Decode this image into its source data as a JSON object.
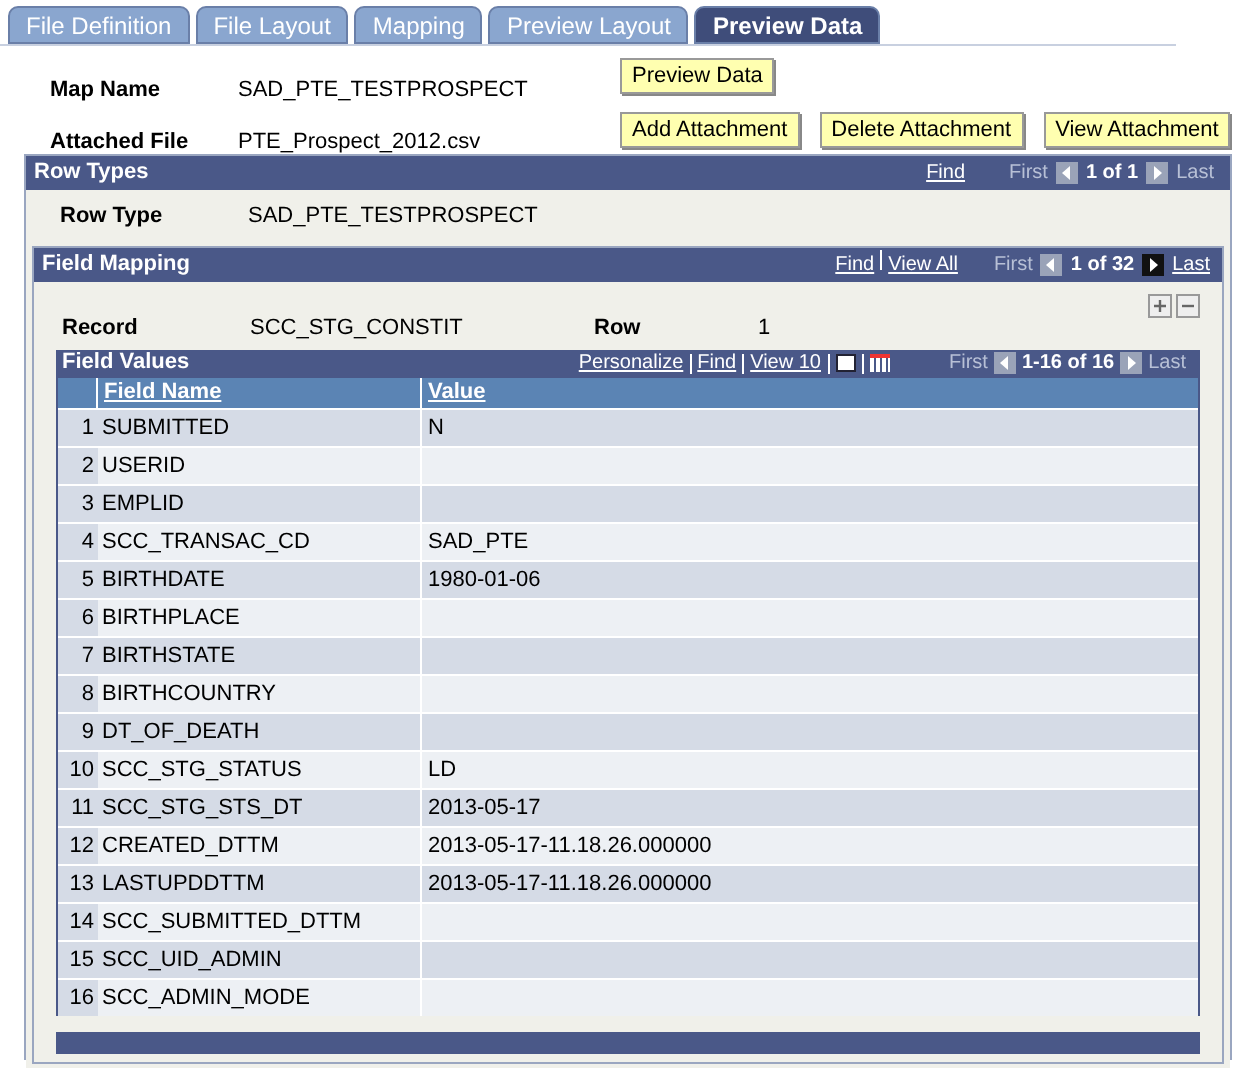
{
  "tabs": [
    {
      "label": "File Definition",
      "selected": false
    },
    {
      "label": "File Layout",
      "selected": false
    },
    {
      "label": "Mapping",
      "selected": false
    },
    {
      "label": "Preview Layout",
      "selected": false
    },
    {
      "label": "Preview Data",
      "selected": true
    }
  ],
  "header": {
    "fields": [
      {
        "label": "Map Name",
        "value": "SAD_PTE_TESTPROSPECT"
      },
      {
        "label": "Attached File",
        "value": "PTE_Prospect_2012.csv"
      }
    ],
    "buttons": [
      "Preview Data",
      "Add Attachment",
      "Delete Attachment",
      "View Attachment"
    ]
  },
  "row_types": {
    "title": "Row Types",
    "nav": {
      "links": [
        "Find"
      ],
      "first": "First",
      "first_enabled": false,
      "counter": "1 of 1",
      "last": "Last",
      "last_enabled": false
    },
    "label": "Row Type",
    "value": "SAD_PTE_TESTPROSPECT"
  },
  "field_mapping": {
    "title": "Field Mapping",
    "nav": {
      "links": [
        "Find",
        "View All"
      ],
      "first": "First",
      "first_enabled": false,
      "counter": "1 of 32",
      "last": "Last",
      "last_enabled": true
    },
    "record_label": "Record",
    "record_value": "SCC_STG_CONSTIT",
    "row_label": "Row",
    "row_value": "1"
  },
  "field_values": {
    "title": "Field Values",
    "links": [
      "Personalize",
      "Find",
      "View 10"
    ],
    "nav": {
      "first": "First",
      "first_enabled": false,
      "counter": "1-16 of 16",
      "last": "Last",
      "last_enabled": false
    },
    "columns": [
      "Field Name",
      "Value"
    ],
    "rows": [
      {
        "number": "1",
        "field_name": "SUBMITTED",
        "value": "N"
      },
      {
        "number": "2",
        "field_name": "USERID",
        "value": ""
      },
      {
        "number": "3",
        "field_name": "EMPLID",
        "value": ""
      },
      {
        "number": "4",
        "field_name": "SCC_TRANSAC_CD",
        "value": "SAD_PTE"
      },
      {
        "number": "5",
        "field_name": "BIRTHDATE",
        "value": "1980-01-06"
      },
      {
        "number": "6",
        "field_name": "BIRTHPLACE",
        "value": ""
      },
      {
        "number": "7",
        "field_name": "BIRTHSTATE",
        "value": ""
      },
      {
        "number": "8",
        "field_name": "BIRTHCOUNTRY",
        "value": ""
      },
      {
        "number": "9",
        "field_name": "DT_OF_DEATH",
        "value": ""
      },
      {
        "number": "10",
        "field_name": "SCC_STG_STATUS",
        "value": "LD"
      },
      {
        "number": "11",
        "field_name": "SCC_STG_STS_DT",
        "value": "2013-05-17"
      },
      {
        "number": "12",
        "field_name": "CREATED_DTTM",
        "value": "2013-05-17-11.18.26.000000"
      },
      {
        "number": "13",
        "field_name": "LASTUPDDTTM",
        "value": "2013-05-17-11.18.26.000000"
      },
      {
        "number": "14",
        "field_name": "SCC_SUBMITTED_DTTM",
        "value": ""
      },
      {
        "number": "15",
        "field_name": "SCC_UID_ADMIN",
        "value": ""
      },
      {
        "number": "16",
        "field_name": "SCC_ADMIN_MODE",
        "value": ""
      }
    ]
  }
}
